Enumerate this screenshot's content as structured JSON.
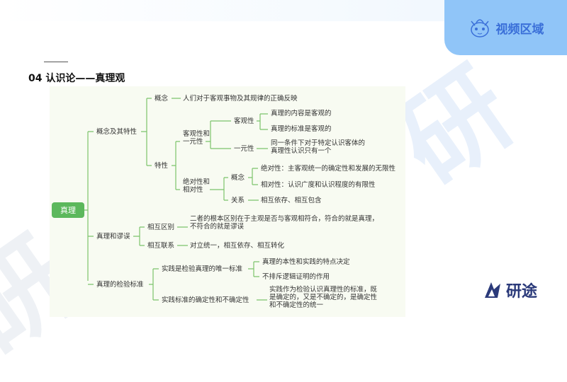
{
  "header": {
    "video_area": "视频区域",
    "title": "04 认识论——真理观"
  },
  "logo": {
    "text": "研途"
  },
  "mindmap": {
    "root": "真理",
    "l1": [
      "概念及其特性",
      "真理和谬误",
      "真理的检验标准"
    ],
    "concept": {
      "label": "概念",
      "text": "人们对于客观事物及其规律的正确反映"
    },
    "traits": {
      "label": "特性",
      "obj_unity": [
        "客观性和",
        "一元性"
      ],
      "objectivity": "客观性",
      "obj_items": [
        "真理的内容是客观的",
        "真理的标准是客观的"
      ],
      "unity": "一元性",
      "unity_text": [
        "同一条件下对于特定认识客体的",
        "真理性认识只有一个"
      ],
      "abs_rel": [
        "绝对性和",
        "相对性"
      ],
      "ar_concept": "概念",
      "ar_items": [
        "绝对性：主客观统一的确定性和发展的无限性",
        "相对性：认识广度和认识程度的有限性"
      ],
      "ar_relation": "关系",
      "ar_relation_text": "相互依存、相互包含"
    },
    "truth_error": {
      "diff": "相互区别",
      "diff_text": [
        "二者的根本区别在于主观是否与客观相符合，符合的就是真理，",
        "不符合的就是谬误"
      ],
      "link": "相互联系",
      "link_text": "对立统一，相互依存、相互转化"
    },
    "criterion": {
      "only": "实践是检验真理的唯一标准",
      "only_items": [
        "真理的本性和实践的特点决定",
        "不排斥逻辑证明的作用"
      ],
      "dual": "实践标准的确定性和不确定性",
      "dual_text": [
        "实践作为检验认识真理性的标准，既",
        "是确定的，又是不确定的，是确定性",
        "和不确定性的统一"
      ]
    }
  }
}
